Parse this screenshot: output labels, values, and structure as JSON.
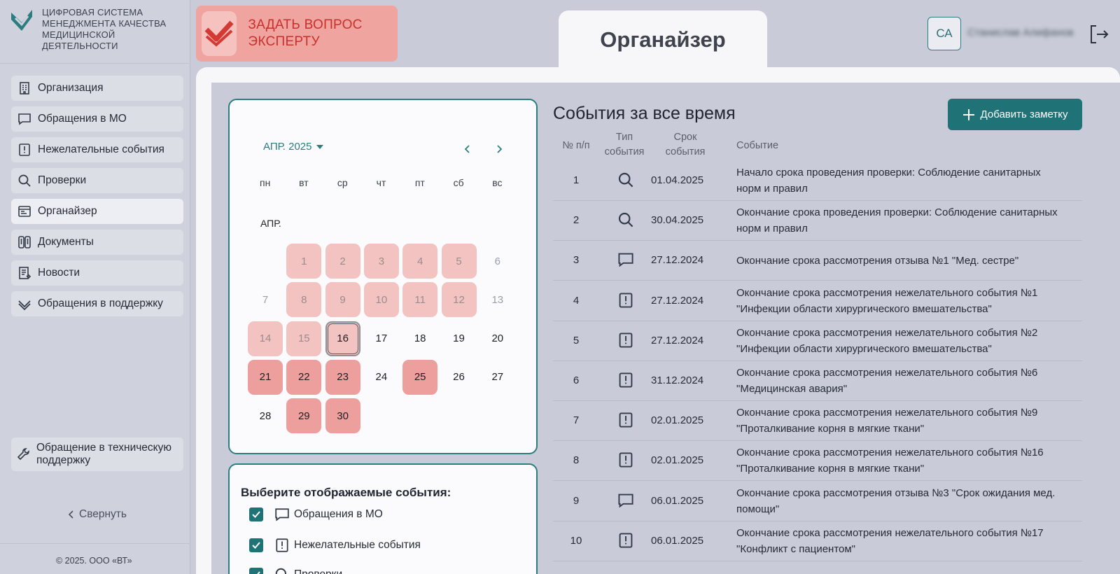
{
  "sidebar": {
    "logo_text": "Цифровая система менеджмента качества медицинской деятельности",
    "items": [
      {
        "label": "Организация",
        "icon": "building-icon"
      },
      {
        "label": "Обращения в МО",
        "icon": "chat-icon"
      },
      {
        "label": "Нежелательные события",
        "icon": "alert-book-icon"
      },
      {
        "label": "Проверки",
        "icon": "search-icon"
      },
      {
        "label": "Органайзер",
        "icon": "organizer-icon"
      },
      {
        "label": "Документы",
        "icon": "documents-icon"
      },
      {
        "label": "Новости",
        "icon": "news-icon"
      },
      {
        "label": "Обращения в поддержку",
        "icon": "support-icon"
      }
    ],
    "tech_support": "Обращение в техническую поддержку",
    "collapse": "Свернуть",
    "copyright": "© 2025. ООО «ВТ»"
  },
  "header": {
    "ask_expert": "Задать вопрос эксперту",
    "page_title": "Органайзер",
    "avatar": "СА",
    "user_name": "Станислав Алифанов"
  },
  "calendar": {
    "month_selector": "АПР. 2025",
    "weekdays": [
      "пн",
      "вт",
      "ср",
      "чт",
      "пт",
      "сб",
      "вс"
    ],
    "month_label": "АПР.",
    "days": [
      {
        "d": "1",
        "s": "light"
      },
      {
        "d": "2",
        "s": "light"
      },
      {
        "d": "3",
        "s": "light"
      },
      {
        "d": "4",
        "s": "light"
      },
      {
        "d": "5",
        "s": "light"
      },
      {
        "d": "6",
        "s": "dim"
      },
      {
        "d": "7",
        "s": "dim"
      },
      {
        "d": "8",
        "s": "light"
      },
      {
        "d": "9",
        "s": "light"
      },
      {
        "d": "10",
        "s": "light"
      },
      {
        "d": "11",
        "s": "light"
      },
      {
        "d": "12",
        "s": "light"
      },
      {
        "d": "13",
        "s": "dim"
      },
      {
        "d": "14",
        "s": "light"
      },
      {
        "d": "15",
        "s": "light"
      },
      {
        "d": "16",
        "s": "today"
      },
      {
        "d": "17",
        "s": ""
      },
      {
        "d": "18",
        "s": ""
      },
      {
        "d": "19",
        "s": ""
      },
      {
        "d": "20",
        "s": ""
      },
      {
        "d": "21",
        "s": "strong"
      },
      {
        "d": "22",
        "s": "strong"
      },
      {
        "d": "23",
        "s": "strong"
      },
      {
        "d": "24",
        "s": ""
      },
      {
        "d": "25",
        "s": "strong"
      },
      {
        "d": "26",
        "s": ""
      },
      {
        "d": "27",
        "s": ""
      },
      {
        "d": "28",
        "s": ""
      },
      {
        "d": "29",
        "s": "strong"
      },
      {
        "d": "30",
        "s": "strong"
      }
    ]
  },
  "filter": {
    "title": "Выберите отображаемые события:",
    "options": [
      {
        "label": "Обращения в МО",
        "checked": true,
        "icon": "chat-icon"
      },
      {
        "label": "Нежелательные события",
        "checked": true,
        "icon": "alert-book-icon"
      },
      {
        "label": "Проверки",
        "checked": true,
        "icon": "search-icon"
      }
    ]
  },
  "events": {
    "title": "События за все время",
    "add_button": "Добавить заметку",
    "columns": [
      "№ п/п",
      "Тип события",
      "Срок события",
      "Событие"
    ],
    "rows": [
      {
        "n": "1",
        "type": "search",
        "date": "01.04.2025",
        "text": "Начало срока проведения проверки: Соблюдение санитарных норм и правил"
      },
      {
        "n": "2",
        "type": "search",
        "date": "30.04.2025",
        "text": "Окончание срока проведения проверки: Соблюдение санитарных норм и правил"
      },
      {
        "n": "3",
        "type": "chat",
        "date": "27.12.2024",
        "text": "Окончание срока рассмотрения отзыва №1 \"Мед. сестре\""
      },
      {
        "n": "4",
        "type": "alert",
        "date": "27.12.2024",
        "text": "Окончание срока рассмотрения нежелательного события №1 \"Инфекции области хирургического вмешательства\""
      },
      {
        "n": "5",
        "type": "alert",
        "date": "27.12.2024",
        "text": "Окончание срока рассмотрения нежелательного события №2 \"Инфекции области хирургического вмешательства\""
      },
      {
        "n": "6",
        "type": "alert",
        "date": "31.12.2024",
        "text": "Окончание срока рассмотрения нежелательного события №6 \"Медицинская авария\""
      },
      {
        "n": "7",
        "type": "alert",
        "date": "02.01.2025",
        "text": "Окончание срока рассмотрения нежелательного события №9 \"Проталкивание корня в мягкие ткани\""
      },
      {
        "n": "8",
        "type": "alert",
        "date": "02.01.2025",
        "text": "Окончание срока рассмотрения нежелательного события №16 \"Проталкивание корня в мягкие ткани\""
      },
      {
        "n": "9",
        "type": "chat",
        "date": "06.01.2025",
        "text": "Окончание срока рассмотрения отзыва №3 \"Срок ожидания мед. помощи\""
      },
      {
        "n": "10",
        "type": "alert",
        "date": "06.01.2025",
        "text": "Окончание срока рассмотрения нежелательного события №17 \"Конфликт с пациентом\""
      }
    ]
  },
  "colors": {
    "accent": "#1f7377",
    "expert_bg": "#f0a4a0",
    "expert_text": "#c9302c",
    "day_light": "#f3c3c1",
    "day_strong": "#ec9f9c"
  }
}
